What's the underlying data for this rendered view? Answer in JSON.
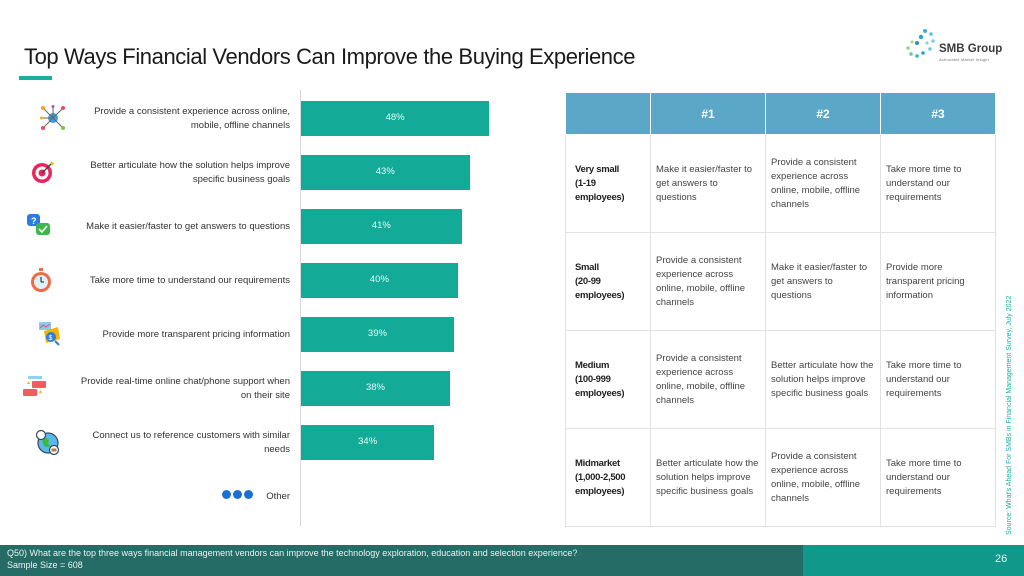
{
  "slide": {
    "title": "Top Ways Financial Vendors Can Improve the Buying Experience",
    "logo": {
      "name": "SMB Group",
      "tagline": "Actionable Market Insight"
    },
    "source": "Source: What's Ahead For SMBs in Financial Management Survey, July 2022",
    "footer": {
      "question": "Q50) What are the top three ways financial management vendors can improve the technology exploration, education and selection experience?",
      "sample_size": "Sample Size = 608",
      "page_number": "26"
    },
    "colors": {
      "bar": "#13ab98",
      "table_header": "#5ba7c7",
      "footer_dark": "#256b66",
      "footer_accent": "#10998a",
      "accent": "#17b0a0"
    }
  },
  "chart_data": {
    "type": "bar",
    "orientation": "horizontal",
    "title": "Top Ways Financial Vendors Can Improve the Buying Experience",
    "categories": [
      "Provide a consistent experience across online, mobile, offline channels",
      "Better articulate how the solution helps improve specific business goals",
      "Make it easier/faster to get answers to questions",
      "Take more time to understand our requirements",
      "Provide more transparent pricing information",
      "Provide real-time online chat/phone support when on their site",
      "Connect us to reference customers with similar needs",
      "Other"
    ],
    "label_lines": [
      [
        "Provide a consistent experience across online,",
        "mobile, offline channels"
      ],
      [
        "Better articulate how the solution helps improve",
        "specific business goals"
      ],
      [
        "Make it easier/faster to get answers to questions"
      ],
      [
        "Take more time to understand our requirements"
      ],
      [
        "Provide more transparent pricing information"
      ],
      [
        "Provide real-time online chat/phone support when",
        "on their site"
      ],
      [
        "Connect us to reference customers with similar",
        "needs"
      ],
      [
        "Other"
      ]
    ],
    "icons": [
      "network-icon",
      "target-icon",
      "chat-question-icon",
      "stopwatch-icon",
      "pricing-icon",
      "chat-support-icon",
      "globe-contact-icon",
      "more-dots-icon"
    ],
    "values": [
      48,
      43,
      41,
      40,
      39,
      38,
      34,
      null
    ],
    "value_labels": [
      "48%",
      "43%",
      "41%",
      "40%",
      "39%",
      "38%",
      "34%",
      ""
    ],
    "unit": "%",
    "xlim": [
      0,
      60
    ],
    "xlabel": "",
    "ylabel": "",
    "grid": false,
    "legend": "none"
  },
  "table": {
    "headers": [
      "",
      "#1",
      "#2",
      "#3"
    ],
    "rows": [
      {
        "segment": [
          "Very small",
          "(1-19",
          "employees)"
        ],
        "cells": [
          "Make it easier/faster to get answers to questions",
          "Provide a consistent experience across online, mobile, offline channels",
          "Take more time to understand our requirements"
        ]
      },
      {
        "segment": [
          "Small",
          "(20-99",
          "employees)"
        ],
        "cells": [
          "Provide a consistent experience across online, mobile, offline channels",
          "Make it easier/faster to get answers to questions",
          "Provide more transparent pricing information"
        ]
      },
      {
        "segment": [
          "Medium",
          "(100-999",
          "employees)"
        ],
        "cells": [
          "Provide a consistent experience across online, mobile, offline channels",
          "Better articulate how the solution helps improve specific business goals",
          "Take more time to understand our requirements"
        ]
      },
      {
        "segment": [
          "Midmarket",
          "(1,000-2,500",
          "employees)"
        ],
        "cells": [
          "Better articulate how the solution helps improve specific business goals",
          "Provide a consistent experience across online, mobile, offline channels",
          "Take more time to understand our requirements"
        ]
      }
    ]
  }
}
